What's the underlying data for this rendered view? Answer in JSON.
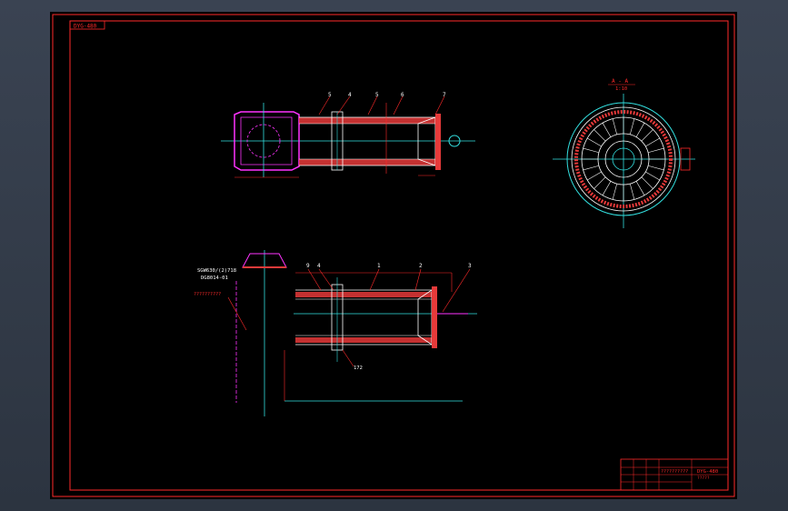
{
  "drawing": {
    "sheet_code": "DYG-480",
    "section_label": "A - A",
    "section_scale": "1:10"
  },
  "balloons_top": [
    "5",
    "4",
    "5",
    "6",
    "7"
  ],
  "balloons_bottom": [
    "9",
    "4",
    "1",
    "2",
    "3"
  ],
  "notes": {
    "spec_line1": "SGW630/(2)718",
    "spec_line2": "DG8014-01",
    "side_note": "??????????",
    "dim_172": "172"
  },
  "title_block": {
    "title": "??????????",
    "code": "DYG-480",
    "company": "?????"
  },
  "colors": {
    "background": "#000000",
    "frame": "#ff2a2a",
    "cyan": "#33e0e0",
    "magenta": "#ff33ff",
    "hatch": "#e63a3a",
    "white": "#ffffff"
  }
}
